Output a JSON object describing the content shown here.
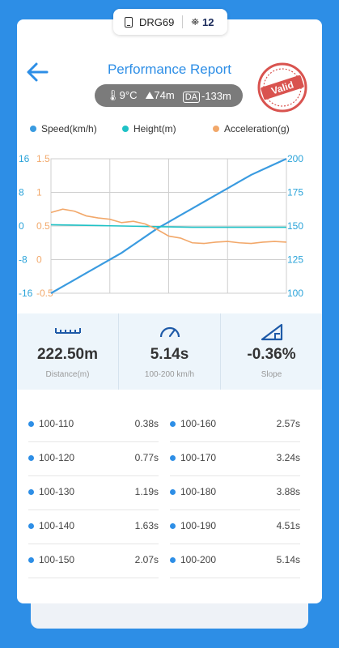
{
  "device": {
    "name": "DRG69",
    "satellites": "12",
    "phone_icon": "phone-icon",
    "sat_icon": "satellite-icon"
  },
  "header": {
    "title": "Performance Report",
    "stamp_text": "Valid"
  },
  "conditions": {
    "temperature": "9°C",
    "altitude": "74m",
    "da_label": "DA",
    "density_altitude": "-133m"
  },
  "legend": [
    {
      "label": "Speed(km/h)",
      "color": "#3a9be0"
    },
    {
      "label": "Height(m)",
      "color": "#1fc2c6"
    },
    {
      "label": "Acceleration(g)",
      "color": "#f2a86a"
    }
  ],
  "chart_data": {
    "type": "line",
    "x": [
      0,
      1,
      2,
      3,
      4,
      5,
      6,
      7,
      8,
      9,
      10,
      11,
      12,
      13,
      14,
      15,
      16,
      17,
      18,
      19,
      20
    ],
    "series": [
      {
        "name": "Speed(km/h)",
        "axis": "right",
        "color": "#3a9be0",
        "values": [
          100,
          105,
          110,
          115,
          120,
          125,
          130,
          136,
          142,
          148,
          153,
          158,
          163,
          168,
          173,
          178,
          183,
          188,
          192,
          196,
          200
        ]
      },
      {
        "name": "Height(m)",
        "axis": "left_blue",
        "color": "#1fc2c6",
        "values": [
          0.3,
          0.25,
          0.2,
          0.15,
          0.1,
          0.05,
          0,
          -0.05,
          -0.1,
          -0.15,
          -0.2,
          -0.25,
          -0.3,
          -0.3,
          -0.3,
          -0.3,
          -0.3,
          -0.3,
          -0.3,
          -0.3,
          -0.3
        ]
      },
      {
        "name": "Acceleration(g)",
        "axis": "left_orange",
        "color": "#f2a86a",
        "values": [
          0.7,
          0.75,
          0.72,
          0.65,
          0.62,
          0.6,
          0.55,
          0.57,
          0.53,
          0.45,
          0.35,
          0.32,
          0.25,
          0.24,
          0.26,
          0.27,
          0.25,
          0.24,
          0.26,
          0.27,
          0.26
        ]
      }
    ],
    "left_blue_ticks": [
      "16",
      "8",
      "0",
      "-8",
      "-16"
    ],
    "left_orange_ticks": [
      "1.5",
      "1",
      "0.5",
      "0",
      "-0.5"
    ],
    "right_ticks": [
      "200",
      "175",
      "150",
      "125",
      "100"
    ],
    "ylim_speed": [
      100,
      200
    ],
    "ylim_accel": [
      -0.5,
      1.5
    ],
    "ylim_height": [
      -16,
      16
    ],
    "grid": true
  },
  "stats": [
    {
      "icon": "ruler-icon",
      "value": "222.50m",
      "label": "Distance(m)"
    },
    {
      "icon": "speedometer-icon",
      "value": "5.14s",
      "label": "100-200 km/h"
    },
    {
      "icon": "slope-icon",
      "value": "-0.36%",
      "label": "Slope"
    }
  ],
  "splits": [
    {
      "name": "100-110",
      "time": "0.38s"
    },
    {
      "name": "100-160",
      "time": "2.57s"
    },
    {
      "name": "100-120",
      "time": "0.77s"
    },
    {
      "name": "100-170",
      "time": "3.24s"
    },
    {
      "name": "100-130",
      "time": "1.19s"
    },
    {
      "name": "100-180",
      "time": "3.88s"
    },
    {
      "name": "100-140",
      "time": "1.63s"
    },
    {
      "name": "100-190",
      "time": "4.51s"
    },
    {
      "name": "100-150",
      "time": "2.07s"
    },
    {
      "name": "100-200",
      "time": "5.14s"
    }
  ]
}
